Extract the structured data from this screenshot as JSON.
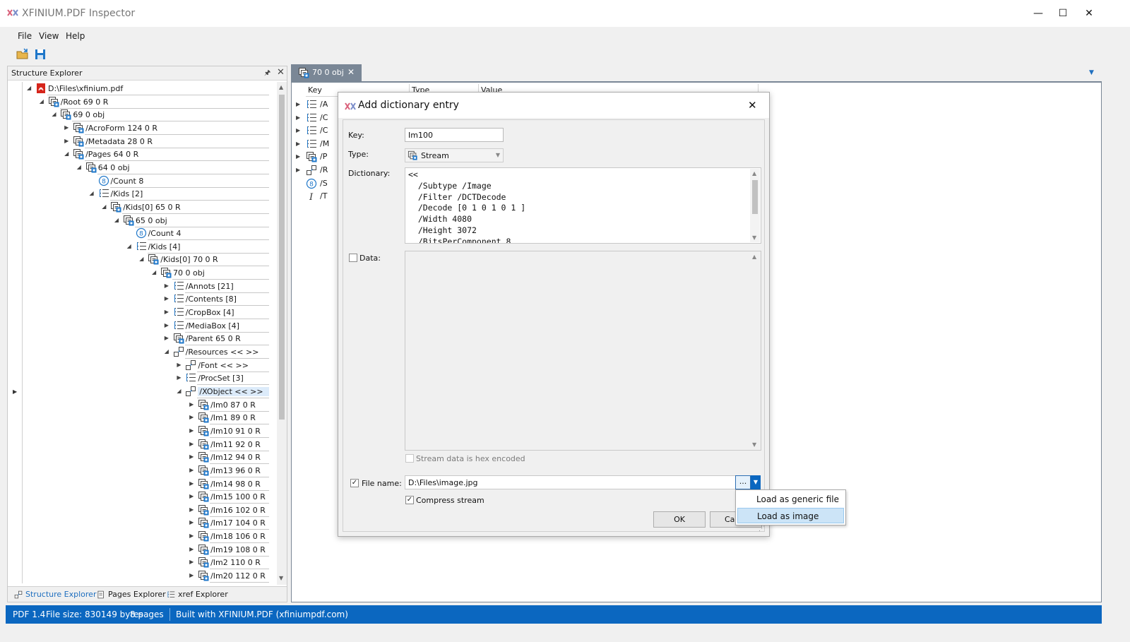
{
  "app": {
    "title": "XFINIUM.PDF Inspector"
  },
  "window_controls": {
    "minimize": "—",
    "maximize": "☐",
    "close": "✕"
  },
  "menu": [
    "File",
    "View",
    "Help"
  ],
  "explorer": {
    "title": "Structure Explorer",
    "pin_glyph": "🖈",
    "close_glyph": "✕",
    "tree": [
      {
        "label": "D:\\Files\\xfinium.pdf",
        "level": 0,
        "expander": "open",
        "icon": "pdf-file-icon"
      },
      {
        "label": "/Root 69 0 R",
        "level": 1,
        "expander": "open",
        "icon": "stream-object-icon"
      },
      {
        "label": "69 0 obj",
        "level": 2,
        "expander": "open",
        "icon": "stream-object-icon"
      },
      {
        "label": "/AcroForm 124 0 R",
        "level": 3,
        "expander": "closed",
        "icon": "stream-object-icon"
      },
      {
        "label": "/Metadata 28 0 R",
        "level": 3,
        "expander": "closed",
        "icon": "stream-object-icon"
      },
      {
        "label": "/Pages 64 0 R",
        "level": 3,
        "expander": "open",
        "icon": "stream-object-icon"
      },
      {
        "label": "64 0 obj",
        "level": 4,
        "expander": "open",
        "icon": "stream-object-icon"
      },
      {
        "label": "/Count 8",
        "level": 5,
        "expander": "none",
        "icon": "number-icon"
      },
      {
        "label": "/Kids [2]",
        "level": 5,
        "expander": "open",
        "icon": "array-icon"
      },
      {
        "label": "/Kids[0] 65 0 R",
        "level": 6,
        "expander": "open",
        "icon": "stream-object-icon"
      },
      {
        "label": "65 0 obj",
        "level": 7,
        "expander": "open",
        "icon": "stream-object-icon"
      },
      {
        "label": "/Count 4",
        "level": 8,
        "expander": "none",
        "icon": "number-icon"
      },
      {
        "label": "/Kids [4]",
        "level": 8,
        "expander": "open",
        "icon": "array-icon"
      },
      {
        "label": "/Kids[0] 70 0 R",
        "level": 9,
        "expander": "open",
        "icon": "stream-object-icon"
      },
      {
        "label": "70 0 obj",
        "level": 10,
        "expander": "open",
        "icon": "stream-object-icon"
      },
      {
        "label": "/Annots [21]",
        "level": 11,
        "expander": "closed",
        "icon": "array-icon"
      },
      {
        "label": "/Contents [8]",
        "level": 11,
        "expander": "closed",
        "icon": "array-icon"
      },
      {
        "label": "/CropBox [4]",
        "level": 11,
        "expander": "closed",
        "icon": "array-icon"
      },
      {
        "label": "/MediaBox [4]",
        "level": 11,
        "expander": "closed",
        "icon": "array-icon"
      },
      {
        "label": "/Parent 65 0 R",
        "level": 11,
        "expander": "closed",
        "icon": "stream-object-icon"
      },
      {
        "label": "/Resources << >>",
        "level": 11,
        "expander": "open",
        "icon": "dictionary-icon"
      },
      {
        "label": "/Font << >>",
        "level": 12,
        "expander": "closed",
        "icon": "dictionary-icon"
      },
      {
        "label": "/ProcSet [3]",
        "level": 12,
        "expander": "closed",
        "icon": "array-icon"
      },
      {
        "label": "/XObject << >>",
        "level": 12,
        "expander": "open",
        "icon": "dictionary-icon",
        "selected": true
      },
      {
        "label": "/Im0 87 0 R",
        "level": 13,
        "expander": "closed",
        "icon": "stream-object-icon"
      },
      {
        "label": "/Im1 89 0 R",
        "level": 13,
        "expander": "closed",
        "icon": "stream-object-icon"
      },
      {
        "label": "/Im10 91 0 R",
        "level": 13,
        "expander": "closed",
        "icon": "stream-object-icon"
      },
      {
        "label": "/Im11 92 0 R",
        "level": 13,
        "expander": "closed",
        "icon": "stream-object-icon"
      },
      {
        "label": "/Im12 94 0 R",
        "level": 13,
        "expander": "closed",
        "icon": "stream-object-icon"
      },
      {
        "label": "/Im13 96 0 R",
        "level": 13,
        "expander": "closed",
        "icon": "stream-object-icon"
      },
      {
        "label": "/Im14 98 0 R",
        "level": 13,
        "expander": "closed",
        "icon": "stream-object-icon"
      },
      {
        "label": "/Im15 100 0 R",
        "level": 13,
        "expander": "closed",
        "icon": "stream-object-icon"
      },
      {
        "label": "/Im16 102 0 R",
        "level": 13,
        "expander": "closed",
        "icon": "stream-object-icon"
      },
      {
        "label": "/Im17 104 0 R",
        "level": 13,
        "expander": "closed",
        "icon": "stream-object-icon"
      },
      {
        "label": "/Im18 106 0 R",
        "level": 13,
        "expander": "closed",
        "icon": "stream-object-icon"
      },
      {
        "label": "/Im19 108 0 R",
        "level": 13,
        "expander": "closed",
        "icon": "stream-object-icon"
      },
      {
        "label": "/Im2 110 0 R",
        "level": 13,
        "expander": "closed",
        "icon": "stream-object-icon"
      },
      {
        "label": "/Im20 112 0 R",
        "level": 13,
        "expander": "closed",
        "icon": "stream-object-icon"
      }
    ],
    "bottom_tabs": [
      "Structure Explorer",
      "Pages Explorer",
      "xref Explorer"
    ]
  },
  "document": {
    "tab_label": "70 0 obj",
    "columns": [
      "Key",
      "Type",
      "Value"
    ],
    "rows": [
      {
        "icon": "array-icon",
        "label": "/A",
        "expander": true
      },
      {
        "icon": "array-icon",
        "label": "/C",
        "expander": true
      },
      {
        "icon": "array-icon",
        "label": "/C",
        "expander": true
      },
      {
        "icon": "array-icon",
        "label": "/M",
        "expander": true
      },
      {
        "icon": "stream-object-icon",
        "label": "/P",
        "expander": true
      },
      {
        "icon": "dictionary-icon",
        "label": "/R",
        "expander": true
      },
      {
        "icon": "number-icon",
        "label": "/S",
        "expander": false
      },
      {
        "icon": "name-icon",
        "label": "/T",
        "expander": false
      }
    ]
  },
  "dialog": {
    "title": "Add dictionary entry",
    "key_label": "Key:",
    "key_value": "Im100",
    "type_label": "Type:",
    "type_value": "Stream",
    "dictionary_label": "Dictionary:",
    "dictionary_text": "<<\n  /Subtype /Image\n  /Filter /DCTDecode\n  /Decode [0 1 0 1 0 1 ]\n  /Width 4080\n  /Height 3072\n  /BitsPerComponent 8",
    "data_label": "Data:",
    "data_checked": false,
    "hex_label": "Stream data is hex encoded",
    "hex_checked": false,
    "filename_label": "File name:",
    "filename_checked": true,
    "filename_value": "D:\\Files\\image.jpg",
    "browse_label": "...",
    "compress_label": "Compress stream",
    "compress_checked": true,
    "ok_label": "OK",
    "cancel_label": "Cancel",
    "menu_items": [
      "Load as generic file",
      "Load as image"
    ],
    "menu_highlighted": 1
  },
  "status": {
    "pdf_version": "PDF 1.4",
    "file_size": "File size: 830149 bytes",
    "pages": "8 pages",
    "built_with": "Built with XFINIUM.PDF (xfiniumpdf.com)"
  },
  "colors": {
    "accent": "#0b67c0",
    "tab_inactive": "#7a8796",
    "selection": "#cce4f7",
    "pdf_red": "#d6251b"
  }
}
